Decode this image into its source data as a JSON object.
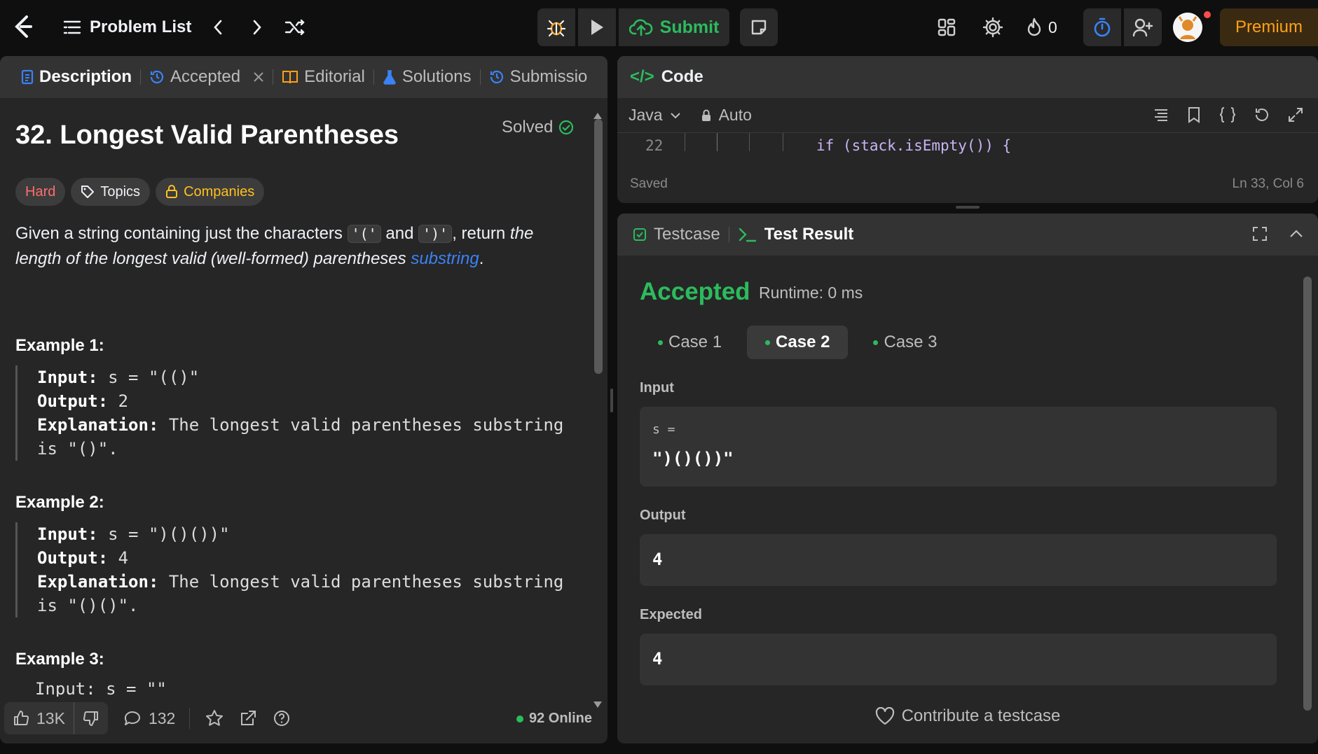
{
  "topbar": {
    "problem_list": "Problem List",
    "submit": "Submit",
    "streak": "0",
    "premium": "Premium"
  },
  "left_tabs": [
    {
      "label": "Description"
    },
    {
      "label": "Accepted"
    },
    {
      "label": "Editorial"
    },
    {
      "label": "Solutions"
    },
    {
      "label": "Submissio"
    }
  ],
  "problem": {
    "title": "32. Longest Valid Parentheses",
    "status": "Solved",
    "difficulty": "Hard",
    "topics": "Topics",
    "companies": "Companies",
    "desc_1": "Given a string containing just the characters ",
    "chip_open": "'('",
    "desc_and": " and ",
    "chip_close": "')'",
    "desc_2": ", return ",
    "desc_italic": "the length of the longest valid (well-formed) parentheses ",
    "desc_link": "substring",
    "desc_end": ".",
    "examples": [
      {
        "title": "Example 1:",
        "input_label": "Input:",
        "input": " s = \"(()\"",
        "output_label": "Output:",
        "output": " 2",
        "expl_label": "Explanation:",
        "expl_1": " The longest valid parentheses substring",
        "expl_2": "is \"()\"."
      },
      {
        "title": "Example 2:",
        "input_label": "Input:",
        "input": " s = \")()())\"",
        "output_label": "Output:",
        "output": " 4",
        "expl_label": "Explanation:",
        "expl_1": " The longest valid parentheses substring",
        "expl_2": "is \"()()\"."
      },
      {
        "title": "Example 3:",
        "partial": "Input: s = \"\""
      }
    ]
  },
  "footer": {
    "likes": "13K",
    "comments": "132",
    "online": "92 Online"
  },
  "code": {
    "title": "Code",
    "language": "Java",
    "mode": "Auto",
    "line_no": "22",
    "line_code": "if (stack.isEmpty()) {",
    "status": "Saved",
    "cursor": "Ln 33, Col 6"
  },
  "result": {
    "tab_testcase": "Testcase",
    "tab_result": "Test Result",
    "verdict": "Accepted",
    "runtime": "Runtime: 0 ms",
    "cases": [
      "Case 1",
      "Case 2",
      "Case 3"
    ],
    "active_case": 1,
    "input_label": "Input",
    "input_key": "s =",
    "input_value": "\")()())\"",
    "output_label": "Output",
    "output_value": "4",
    "expected_label": "Expected",
    "expected_value": "4",
    "contribute": "Contribute a testcase"
  },
  "colors": {
    "accent_green": "#2cbb5d",
    "hard_red": "#ff6d6d",
    "premium_orange": "#ffa116",
    "link_blue": "#3b82f6"
  }
}
